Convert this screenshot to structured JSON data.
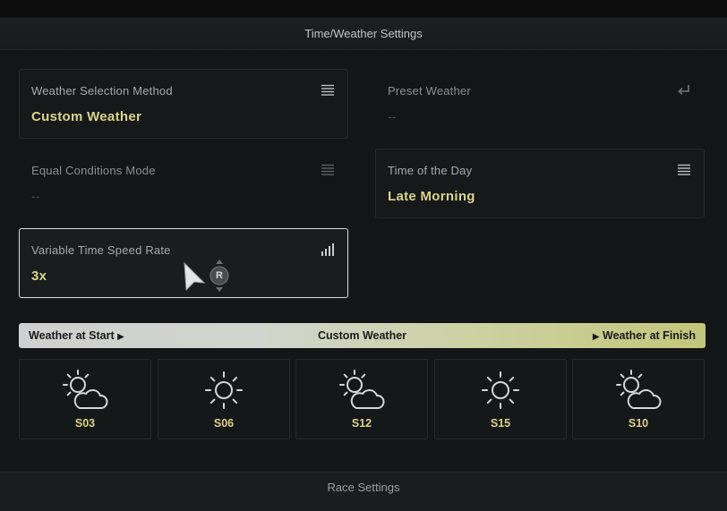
{
  "header": {
    "title": "Time/Weather Settings"
  },
  "settings": {
    "weather_method": {
      "label": "Weather Selection Method",
      "value": "Custom Weather",
      "icon": "list-icon"
    },
    "preset_weather": {
      "label": "Preset Weather",
      "value": "--",
      "icon": "return-icon"
    },
    "equal_conditions": {
      "label": "Equal Conditions Mode",
      "value": "--",
      "icon": "list-icon"
    },
    "time_of_day": {
      "label": "Time of the Day",
      "value": "Late Morning",
      "icon": "list-icon"
    },
    "time_speed": {
      "label": "Variable Time Speed Rate",
      "value": "3x",
      "icon": "signal-bars-icon"
    }
  },
  "controller": {
    "button_label": "R"
  },
  "weather_bar": {
    "start_label": "Weather at Start",
    "center_label": "Custom Weather",
    "finish_label": "Weather at Finish"
  },
  "weather_slots": [
    {
      "code": "S03",
      "icon": "partly-cloudy-icon"
    },
    {
      "code": "S06",
      "icon": "sun-icon"
    },
    {
      "code": "S12",
      "icon": "partly-cloudy-icon"
    },
    {
      "code": "S15",
      "icon": "sun-icon"
    },
    {
      "code": "S10",
      "icon": "partly-cloudy-icon"
    }
  ],
  "footer": {
    "title": "Race Settings"
  },
  "colors": {
    "accent": "#d8d68a",
    "background": "#141517",
    "focus_border": "#d9dadc"
  }
}
